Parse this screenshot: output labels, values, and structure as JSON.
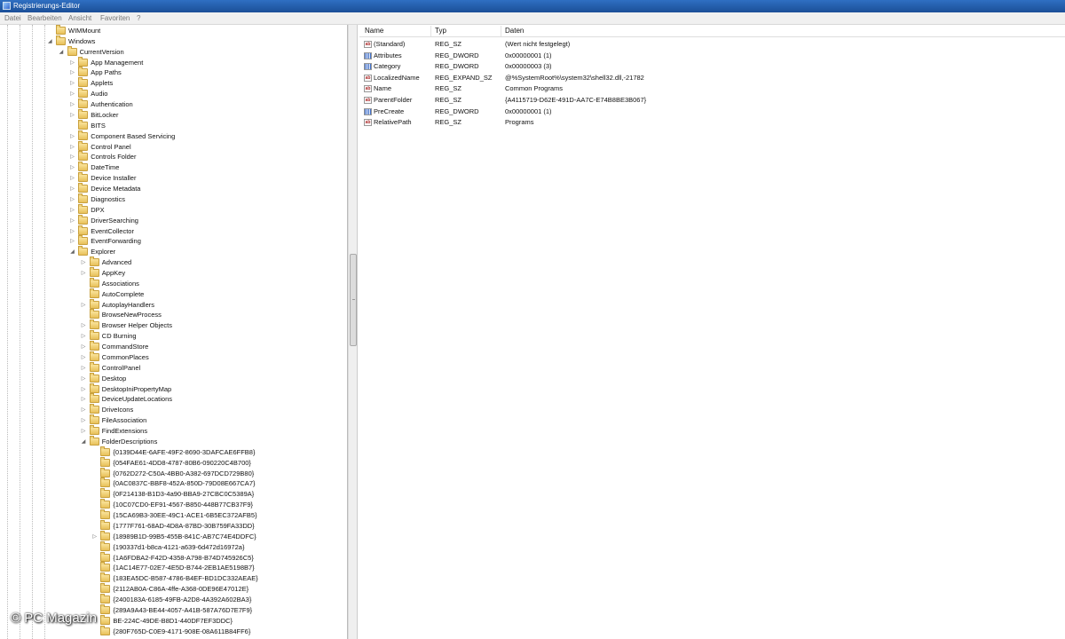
{
  "window": {
    "title": "Registrierungs-Editor"
  },
  "menu": [
    "Datei",
    "Bearbeiten",
    "Ansicht",
    "Favoriten",
    "?"
  ],
  "tree": [
    {
      "label": "WIMMount",
      "depth": 0,
      "expander": ""
    },
    {
      "label": "Windows",
      "depth": 0,
      "expander": "open"
    },
    {
      "label": "CurrentVersion",
      "depth": 1,
      "expander": "open"
    },
    {
      "label": "App Management",
      "depth": 2,
      "expander": "closed"
    },
    {
      "label": "App Paths",
      "depth": 2,
      "expander": "closed"
    },
    {
      "label": "Applets",
      "depth": 2,
      "expander": "closed"
    },
    {
      "label": "Audio",
      "depth": 2,
      "expander": "closed"
    },
    {
      "label": "Authentication",
      "depth": 2,
      "expander": "closed"
    },
    {
      "label": "BitLocker",
      "depth": 2,
      "expander": "closed"
    },
    {
      "label": "BITS",
      "depth": 2,
      "expander": ""
    },
    {
      "label": "Component Based Servicing",
      "depth": 2,
      "expander": "closed"
    },
    {
      "label": "Control Panel",
      "depth": 2,
      "expander": "closed"
    },
    {
      "label": "Controls Folder",
      "depth": 2,
      "expander": "closed"
    },
    {
      "label": "DateTime",
      "depth": 2,
      "expander": "closed"
    },
    {
      "label": "Device Installer",
      "depth": 2,
      "expander": "closed"
    },
    {
      "label": "Device Metadata",
      "depth": 2,
      "expander": "closed"
    },
    {
      "label": "Diagnostics",
      "depth": 2,
      "expander": "closed"
    },
    {
      "label": "DPX",
      "depth": 2,
      "expander": "closed"
    },
    {
      "label": "DriverSearching",
      "depth": 2,
      "expander": "closed"
    },
    {
      "label": "EventCollector",
      "depth": 2,
      "expander": "closed"
    },
    {
      "label": "EventForwarding",
      "depth": 2,
      "expander": "closed"
    },
    {
      "label": "Explorer",
      "depth": 2,
      "expander": "open"
    },
    {
      "label": "Advanced",
      "depth": 3,
      "expander": "closed"
    },
    {
      "label": "AppKey",
      "depth": 3,
      "expander": "closed"
    },
    {
      "label": "Associations",
      "depth": 3,
      "expander": ""
    },
    {
      "label": "AutoComplete",
      "depth": 3,
      "expander": ""
    },
    {
      "label": "AutoplayHandlers",
      "depth": 3,
      "expander": "closed"
    },
    {
      "label": "BrowseNewProcess",
      "depth": 3,
      "expander": ""
    },
    {
      "label": "Browser Helper Objects",
      "depth": 3,
      "expander": "closed"
    },
    {
      "label": "CD Burning",
      "depth": 3,
      "expander": "closed"
    },
    {
      "label": "CommandStore",
      "depth": 3,
      "expander": "closed"
    },
    {
      "label": "CommonPlaces",
      "depth": 3,
      "expander": "closed"
    },
    {
      "label": "ControlPanel",
      "depth": 3,
      "expander": "closed"
    },
    {
      "label": "Desktop",
      "depth": 3,
      "expander": "closed"
    },
    {
      "label": "DesktopIniPropertyMap",
      "depth": 3,
      "expander": "closed"
    },
    {
      "label": "DeviceUpdateLocations",
      "depth": 3,
      "expander": "closed"
    },
    {
      "label": "DriveIcons",
      "depth": 3,
      "expander": "closed"
    },
    {
      "label": "FileAssociation",
      "depth": 3,
      "expander": "closed"
    },
    {
      "label": "FindExtensions",
      "depth": 3,
      "expander": "closed"
    },
    {
      "label": "FolderDescriptions",
      "depth": 3,
      "expander": "open"
    },
    {
      "label": "{0139D44E-6AFE-49F2-8690-3DAFCAE6FFB8}",
      "depth": 4,
      "expander": ""
    },
    {
      "label": "{054FAE61-4DD8-4787-80B6-090220C4B700}",
      "depth": 4,
      "expander": ""
    },
    {
      "label": "{0762D272-C50A-4BB0-A382-697DCD729B80}",
      "depth": 4,
      "expander": ""
    },
    {
      "label": "{0AC0837C-BBF8-452A-850D-79D08E667CA7}",
      "depth": 4,
      "expander": ""
    },
    {
      "label": "{0F214138-B1D3-4a90-BBA9-27CBC0C5389A}",
      "depth": 4,
      "expander": ""
    },
    {
      "label": "{10C07CD0-EF91-4567-B850-448B77CB37F9}",
      "depth": 4,
      "expander": ""
    },
    {
      "label": "{15CA69B3-30EE-49C1-ACE1-6B5EC372AFB5}",
      "depth": 4,
      "expander": ""
    },
    {
      "label": "{1777F761-68AD-4D8A-87BD-30B759FA33DD}",
      "depth": 4,
      "expander": ""
    },
    {
      "label": "{18989B1D-99B5-455B-841C-AB7C74E4DDFC}",
      "depth": 4,
      "expander": "closed"
    },
    {
      "label": "{190337d1-b8ca-4121-a639-6d472d16972a}",
      "depth": 4,
      "expander": ""
    },
    {
      "label": "{1A6FDBA2-F42D-4358-A798-B74D745926C5}",
      "depth": 4,
      "expander": ""
    },
    {
      "label": "{1AC14E77-02E7-4E5D-B744-2EB1AE5198B7}",
      "depth": 4,
      "expander": ""
    },
    {
      "label": "{183EA5DC-B587-4786-B4EF-BD1DC332AEAE}",
      "depth": 4,
      "expander": ""
    },
    {
      "label": "{2112AB0A-C86A-4ffe-A368-0DE96E47012E}",
      "depth": 4,
      "expander": ""
    },
    {
      "label": "{2400183A-6185-49FB-A2D8-4A392A602BA3}",
      "depth": 4,
      "expander": ""
    },
    {
      "label": "{289A9A43-BE44-4057-A41B-587A76D7E7F9}",
      "depth": 4,
      "expander": ""
    },
    {
      "label": "BE-224C-49DE-B8D1-440DF7EF3DDC}",
      "depth": 4,
      "expander": ""
    },
    {
      "label": "{280F765D-C0E9-4171-908E-08A611B84FF6}",
      "depth": 4,
      "expander": ""
    }
  ],
  "values": {
    "columns": [
      "Name",
      "Typ",
      "Daten"
    ],
    "rows": [
      {
        "icon": "string-value-icon",
        "name": "(Standard)",
        "type": "REG_SZ",
        "data": "(Wert nicht festgelegt)"
      },
      {
        "icon": "binary-value-icon",
        "name": "Attributes",
        "type": "REG_DWORD",
        "data": "0x00000001 (1)"
      },
      {
        "icon": "binary-value-icon",
        "name": "Category",
        "type": "REG_DWORD",
        "data": "0x00000003 (3)"
      },
      {
        "icon": "string-value-icon",
        "name": "LocalizedName",
        "type": "REG_EXPAND_SZ",
        "data": "@%SystemRoot%\\system32\\shell32.dll,-21782"
      },
      {
        "icon": "string-value-icon",
        "name": "Name",
        "type": "REG_SZ",
        "data": "Common Programs"
      },
      {
        "icon": "string-value-icon",
        "name": "ParentFolder",
        "type": "REG_SZ",
        "data": "{A4115719-D62E-491D-AA7C-E74B8BE3B067}"
      },
      {
        "icon": "binary-value-icon",
        "name": "PreCreate",
        "type": "REG_DWORD",
        "data": "0x00000001 (1)"
      },
      {
        "icon": "string-value-icon",
        "name": "RelativePath",
        "type": "REG_SZ",
        "data": "Programs"
      }
    ]
  },
  "watermark": "© PC Magazin"
}
